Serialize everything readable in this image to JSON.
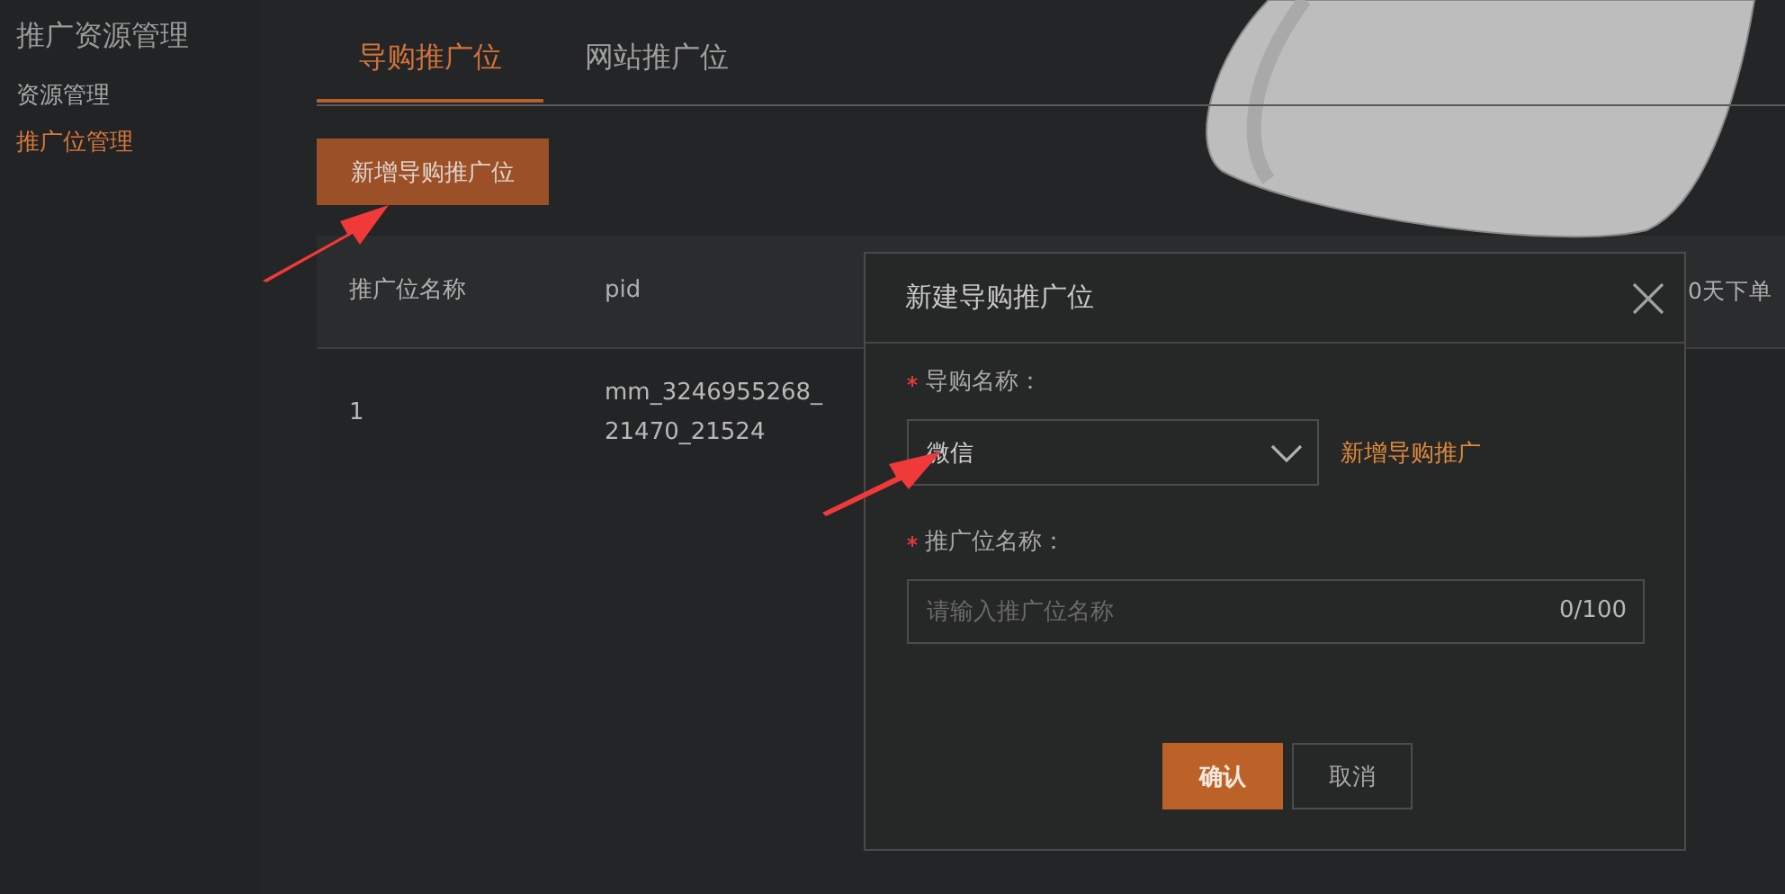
{
  "sidebar": {
    "title": "推广资源管理",
    "items": [
      {
        "label": "资源管理",
        "selected": false
      },
      {
        "label": "推广位管理",
        "selected": true
      }
    ]
  },
  "tabs": [
    {
      "label": "导购推广位",
      "selected": true
    },
    {
      "label": "网站推广位",
      "selected": false
    }
  ],
  "add_button": "新增导购推广位",
  "table": {
    "columns": [
      "推广位名称",
      "pid",
      "0天下单"
    ],
    "rows": [
      [
        "1",
        "mm_3246955268_21470_21524"
      ]
    ]
  },
  "dialog": {
    "title": "新建导购推广位",
    "fields": [
      {
        "kind": "select",
        "label": "导购名称：",
        "required": true,
        "value": "微信",
        "link": "新增导购推广"
      },
      {
        "kind": "text",
        "label": "推广位名称：",
        "required": true,
        "placeholder": "请输入推广位名称",
        "counter": "0/100"
      }
    ],
    "buttons": [
      {
        "label": "确认",
        "primary": true
      },
      {
        "label": "取消",
        "primary": false
      }
    ]
  }
}
